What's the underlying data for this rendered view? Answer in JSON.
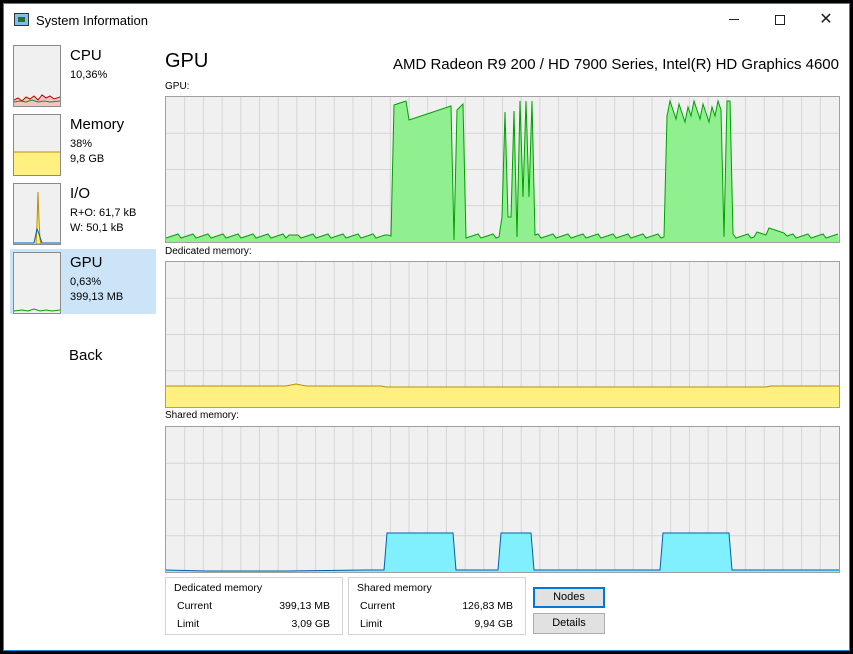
{
  "window": {
    "title": "System Information"
  },
  "sidebar": {
    "items": [
      {
        "title": "CPU",
        "line1": "10,36%",
        "line2": ""
      },
      {
        "title": "Memory",
        "line1": "38%",
        "line2": "9,8 GB"
      },
      {
        "title": "I/O",
        "line1": "R+O: 61,7 kB",
        "line2": "W: 50,1 kB"
      },
      {
        "title": "GPU",
        "line1": "0,63%",
        "line2": "399,13 MB"
      }
    ],
    "back_label": "Back"
  },
  "main": {
    "title": "GPU",
    "device_name": "AMD Radeon R9 200 / HD 7900 Series, Intel(R) HD Graphics 4600",
    "graphs": [
      {
        "label": "GPU:",
        "fill": "#90f090",
        "stroke": "#00a000"
      },
      {
        "label": "Dedicated memory:",
        "fill": "#fff080",
        "stroke": "#b89000"
      },
      {
        "label": "Shared memory:",
        "fill": "#80f0ff",
        "stroke": "#0060b0"
      }
    ]
  },
  "dedicated_memory": {
    "title": "Dedicated memory",
    "current_label": "Current",
    "current_value": "399,13 MB",
    "limit_label": "Limit",
    "limit_value": "3,09 GB"
  },
  "shared_memory": {
    "title": "Shared memory",
    "current_label": "Current",
    "current_value": "126,83 MB",
    "limit_label": "Limit",
    "limit_value": "9,94 GB"
  },
  "buttons": {
    "nodes_label": "Nodes",
    "details_label": "Details"
  },
  "icons": {
    "app": "monitor-icon",
    "minimize": "minimize-icon",
    "maximize": "maximize-icon",
    "close": "close-icon"
  }
}
